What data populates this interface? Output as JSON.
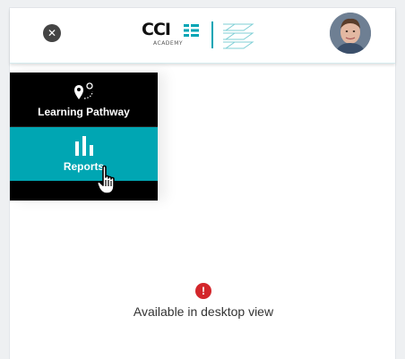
{
  "header": {
    "close_label": "✕",
    "logo": {
      "wordmark": "CCI",
      "subtitle": "ACADEMY",
      "brand_color": "#00a5b5"
    },
    "avatar_alt": "User avatar"
  },
  "menu": {
    "items": [
      {
        "label": "Learning Pathway",
        "icon": "map-pin-route-icon",
        "active": false
      },
      {
        "label": "Reports",
        "icon": "bar-chart-icon",
        "active": true
      }
    ],
    "background": "#000000",
    "active_color": "#00a6b3"
  },
  "notice": {
    "icon": "alert-icon",
    "icon_glyph": "!",
    "text": "Available in desktop view",
    "icon_color": "#d3262b"
  }
}
